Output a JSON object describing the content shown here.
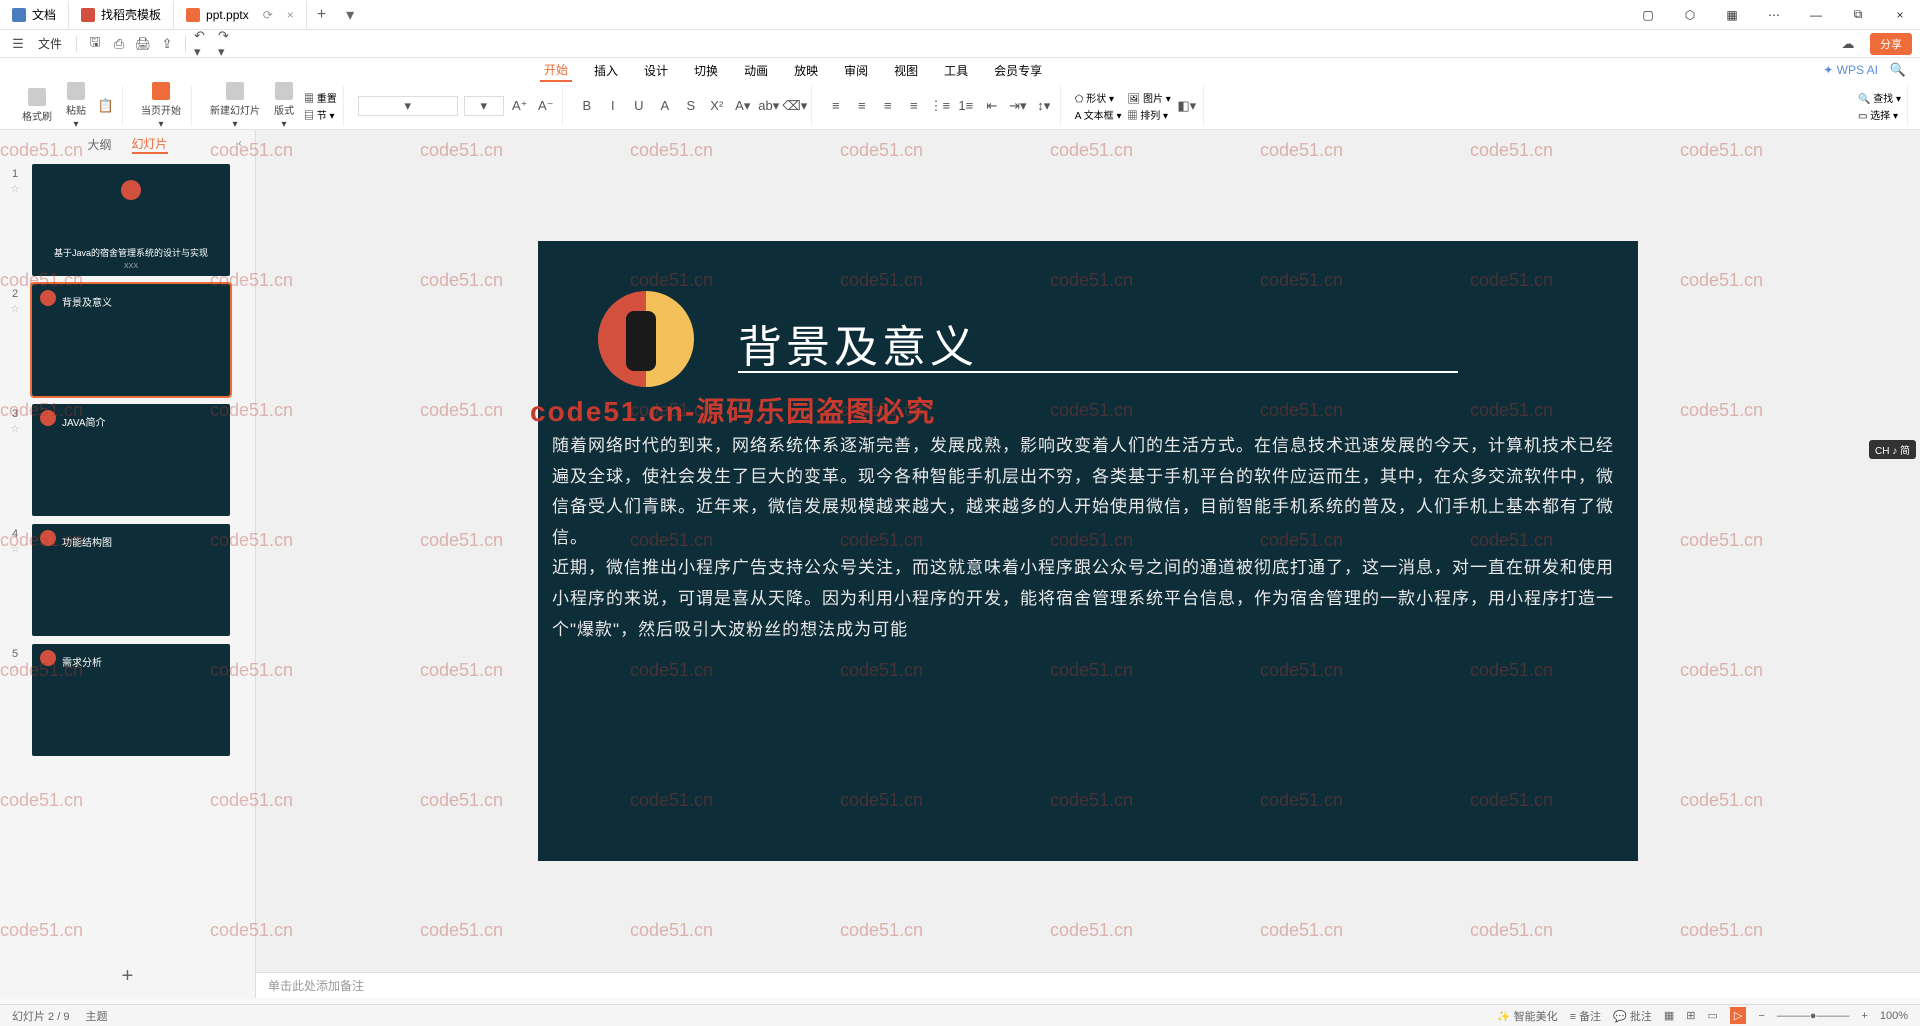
{
  "tabs": {
    "t1": "文档",
    "t2": "找稻壳模板",
    "t3": "ppt.pptx"
  },
  "menu": {
    "file": "文件",
    "share": "分享"
  },
  "ribbon": {
    "start": "开始",
    "insert": "插入",
    "design": "设计",
    "transition": "切换",
    "animation": "动画",
    "slideshow": "放映",
    "review": "审阅",
    "view": "视图",
    "tools": "工具",
    "member": "会员专享",
    "wpsai": "WPS AI"
  },
  "tools": {
    "format_painter": "格式刷",
    "paste": "粘贴",
    "from_current": "当页开始",
    "new_slide": "新建幻灯片",
    "layout": "版式",
    "reset": "重置",
    "section": "节",
    "shape": "形状",
    "picture": "图片",
    "textbox": "文本框",
    "arrange": "排列",
    "find": "查找",
    "select": "选择"
  },
  "sidepanel": {
    "outline": "大纲",
    "slides": "幻灯片"
  },
  "thumbs": {
    "t1_title": "基于Java的宿舍管理系统的设计与实现",
    "t1_sub": "XXX",
    "t2_title": "背景及意义",
    "t3_title": "JAVA简介",
    "t4_title": "功能结构图",
    "t5_title": "需求分析"
  },
  "slide": {
    "title": "背景及意义",
    "body_p1": "随着网络时代的到来，网络系统体系逐渐完善，发展成熟，影响改变着人们的生活方式。在信息技术迅速发展的今天，计算机技术已经遍及全球，使社会发生了巨大的变革。现今各种智能手机层出不穷，各类基于手机平台的软件应运而生，其中，在众多交流软件中，微信备受人们青睐。近年来，微信发展规模越来越大，越来越多的人开始使用微信，目前智能手机系统的普及，人们手机上基本都有了微信。",
    "body_p2": "近期，微信推出小程序广告支持公众号关注，而这就意味着小程序跟公众号之间的通道被彻底打通了，这一消息，对一直在研发和使用小程序的来说，可谓是喜从天降。因为利用小程序的开发，能将宿舍管理系统平台信息，作为宿舍管理的一款小程序，用小程序打造一个\"爆款\"，然后吸引大波粉丝的想法成为可能"
  },
  "notes": {
    "placeholder": "单击此处添加备注"
  },
  "status": {
    "slide_pos": "幻灯片 2 / 9",
    "theme": "主题",
    "beautify": "智能美化",
    "notes_btn": "备注",
    "comments": "批注",
    "zoom": "100%"
  },
  "ime": "CH ♪ 简",
  "overlay": "code51.cn-源码乐园盗图必究",
  "wm": "code51.cn"
}
